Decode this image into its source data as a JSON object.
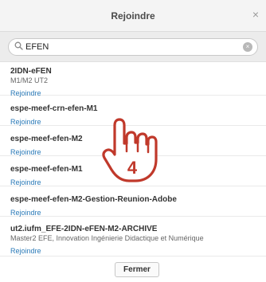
{
  "dialog": {
    "title": "Rejoindre",
    "close_glyph": "×",
    "close_icon": "close-icon"
  },
  "search": {
    "value": "EFEN",
    "icon": "search-icon",
    "clear_icon": "clear-circle-icon",
    "clear_glyph": "×"
  },
  "items": [
    {
      "name": "2IDN-eFEN",
      "desc": "M1/M2 UT2",
      "link": "Rejoindre"
    },
    {
      "name": "espe-meef-crn-efen-M1",
      "desc": "",
      "link": "Rejoindre"
    },
    {
      "name": "espe-meef-efen-M2",
      "desc": "",
      "link": "Rejoindre"
    },
    {
      "name": "espe-meef-efen-M1",
      "desc": "",
      "link": "Rejoindre"
    },
    {
      "name": "espe-meef-efen-M2-Gestion-Reunion-Adobe",
      "desc": "",
      "link": "Rejoindre"
    },
    {
      "name": "ut2.iufm_EFE-2IDN-eFEN-M2-ARCHIVE",
      "desc": "Master2 EFE, Innovation Ingénierie Didactique et Numérique",
      "link": "Rejoindre"
    }
  ],
  "footer": {
    "close_label": "Fermer"
  },
  "annotation": {
    "number": "4",
    "icon": "pointing-hand-icon",
    "color": "#c0392b"
  }
}
